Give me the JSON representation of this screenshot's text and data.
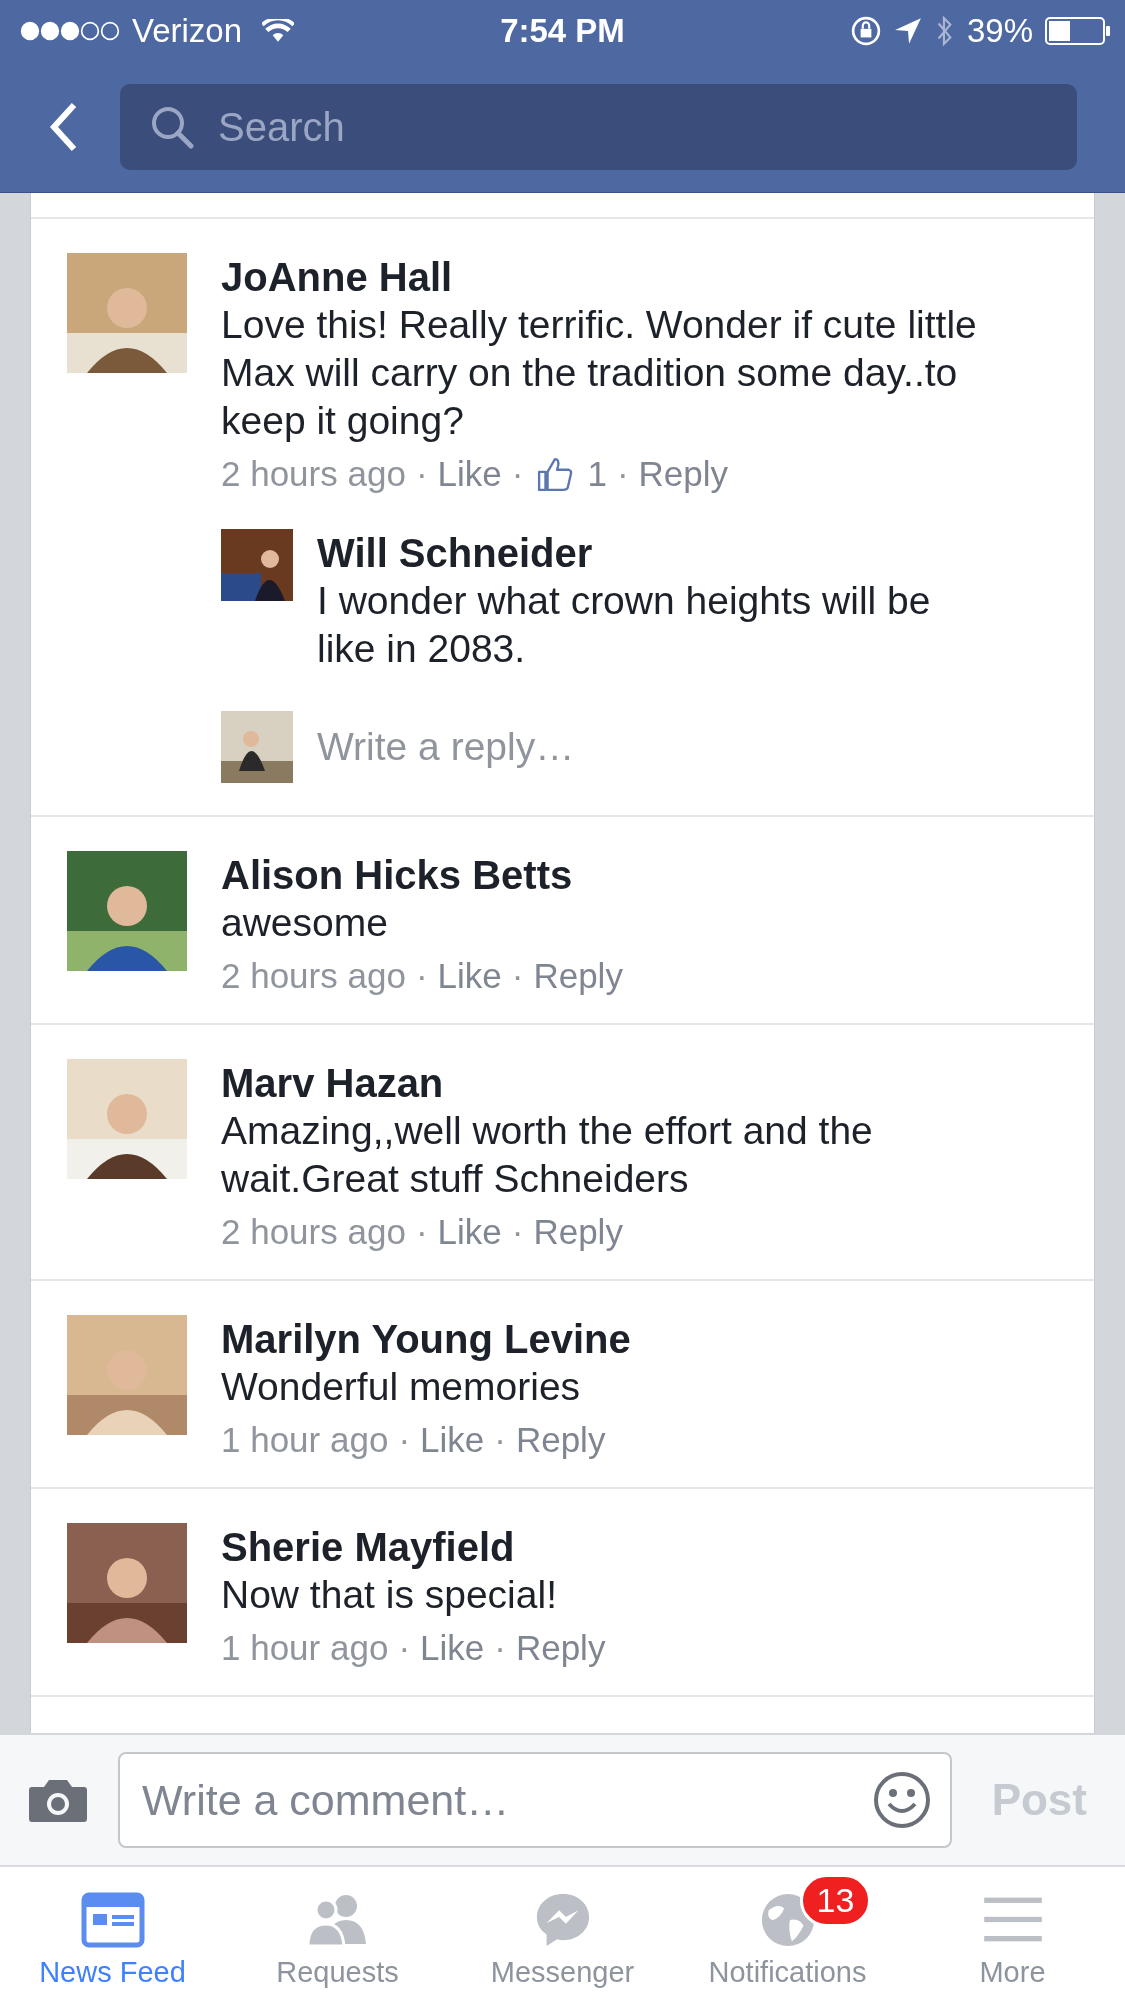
{
  "status_bar": {
    "carrier": "Verizon",
    "time": "7:54 PM",
    "battery": "39%"
  },
  "search": {
    "placeholder": "Search"
  },
  "separator": "·",
  "comments": [
    {
      "name": "JoAnne Hall",
      "text": "Love this! Really terrific. Wonder if cute little Max will carry on the tradition some day..to keep it going?",
      "time": "2 hours ago",
      "like": "Like",
      "like_count": "1",
      "reply": "Reply",
      "replies": [
        {
          "name": "Will Schneider",
          "text": "I wonder what crown heights will be like in 2083."
        }
      ],
      "reply_field": {
        "placeholder": "Write a reply…"
      }
    },
    {
      "name": "Alison Hicks Betts",
      "text": "awesome",
      "time": "2 hours ago",
      "like": "Like",
      "reply": "Reply"
    },
    {
      "name": "Marv Hazan",
      "text": "Amazing,,well worth the effort and the wait.Great stuff Schneiders",
      "time": "2 hours ago",
      "like": "Like",
      "reply": "Reply"
    },
    {
      "name": "Marilyn Young Levine",
      "text": "Wonderful memories",
      "time": "1 hour ago",
      "like": "Like",
      "reply": "Reply"
    },
    {
      "name": "Sherie Mayfield",
      "text": "Now that is special!",
      "time": "1 hour ago",
      "like": "Like",
      "reply": "Reply"
    }
  ],
  "composer": {
    "placeholder": "Write a comment…",
    "post": "Post",
    "post_disabled": true
  },
  "tabs": [
    {
      "kind": "feed",
      "label": "News Feed",
      "selected": true
    },
    {
      "kind": "requests",
      "label": "Requests",
      "selected": false
    },
    {
      "kind": "messenger",
      "label": "Messenger",
      "selected": false
    },
    {
      "kind": "notifications",
      "label": "Notifications",
      "selected": false,
      "badge": "13"
    },
    {
      "kind": "more",
      "label": "More",
      "selected": false
    }
  ]
}
